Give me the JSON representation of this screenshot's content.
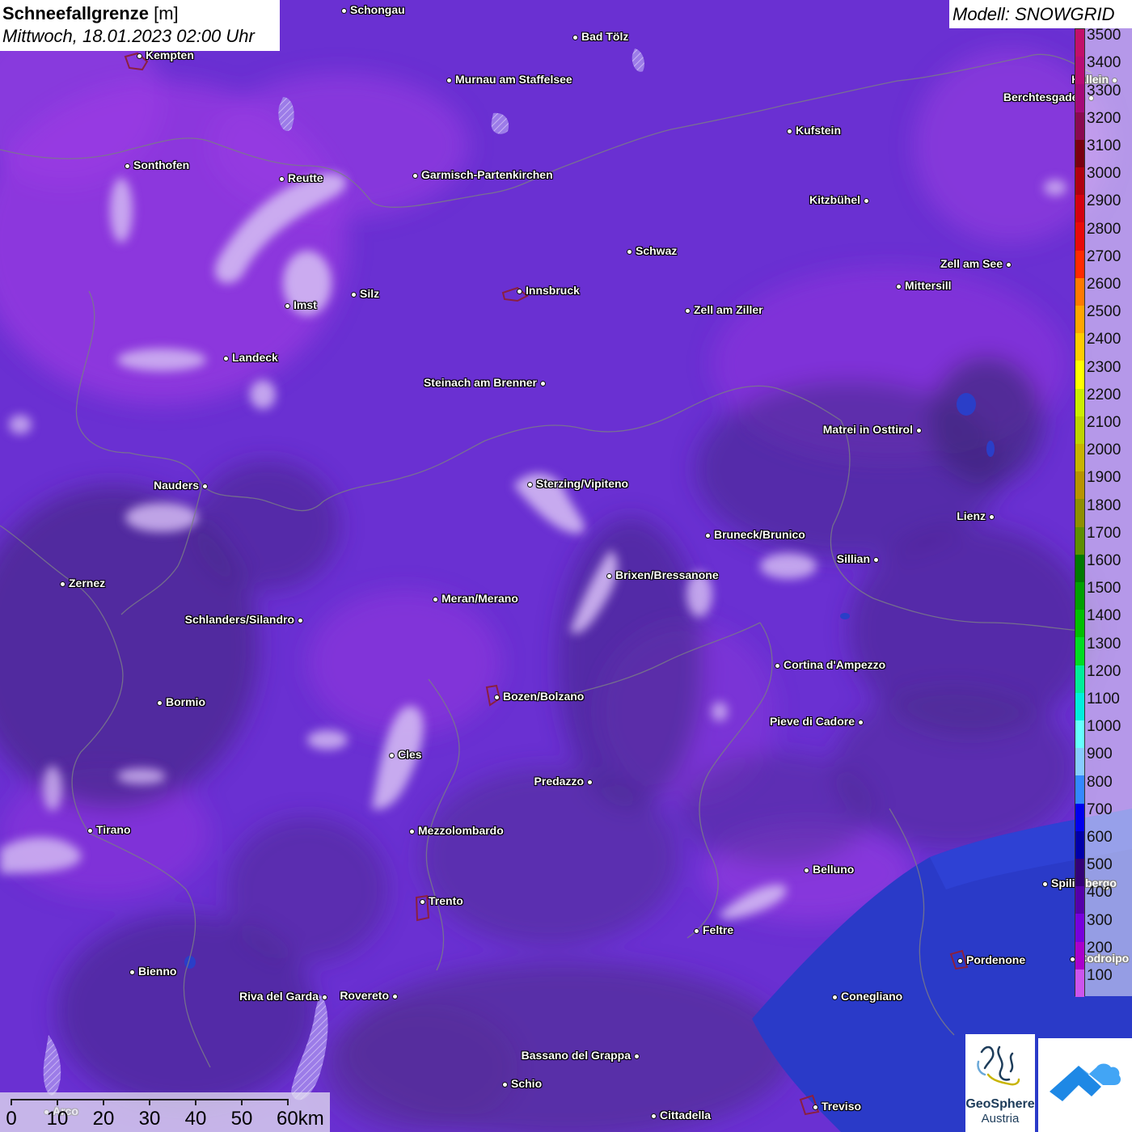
{
  "title": {
    "variable": "Schneefallgrenze",
    "unit": "[m]",
    "datetime": "Mittwoch, 18.01.2023 02:00 Uhr"
  },
  "model": {
    "label": "Modell: SNOWGRID"
  },
  "legend": {
    "levels": [
      {
        "label": "3500",
        "color": "#c2106a"
      },
      {
        "label": "3400",
        "color": "#b80c75"
      },
      {
        "label": "3300",
        "color": "#a50a78"
      },
      {
        "label": "3200",
        "color": "#8a0a50"
      },
      {
        "label": "3100",
        "color": "#7a0010"
      },
      {
        "label": "3000",
        "color": "#b00010"
      },
      {
        "label": "2900",
        "color": "#d40010"
      },
      {
        "label": "2800",
        "color": "#e80a0a"
      },
      {
        "label": "2700",
        "color": "#ff2a00"
      },
      {
        "label": "2600",
        "color": "#ff7a00"
      },
      {
        "label": "2500",
        "color": "#ffa600"
      },
      {
        "label": "2400",
        "color": "#ffcc00"
      },
      {
        "label": "2300",
        "color": "#ffff00"
      },
      {
        "label": "2200",
        "color": "#ccee00"
      },
      {
        "label": "2100",
        "color": "#bfd400"
      },
      {
        "label": "2000",
        "color": "#c8b400"
      },
      {
        "label": "1900",
        "color": "#b89400"
      },
      {
        "label": "1800",
        "color": "#8f8f00"
      },
      {
        "label": "1700",
        "color": "#5e8f00"
      },
      {
        "label": "1600",
        "color": "#007a00"
      },
      {
        "label": "1500",
        "color": "#00a000"
      },
      {
        "label": "1400",
        "color": "#00c000"
      },
      {
        "label": "1300",
        "color": "#00dd22"
      },
      {
        "label": "1200",
        "color": "#00ee99"
      },
      {
        "label": "1100",
        "color": "#00eedd"
      },
      {
        "label": "1000",
        "color": "#66ffff"
      },
      {
        "label": "900",
        "color": "#88ccff"
      },
      {
        "label": "800",
        "color": "#3388ff"
      },
      {
        "label": "700",
        "color": "#0000ee"
      },
      {
        "label": "600",
        "color": "#0000aa"
      },
      {
        "label": "500",
        "color": "#330077"
      },
      {
        "label": "400",
        "color": "#5500aa"
      },
      {
        "label": "300",
        "color": "#7700dd"
      },
      {
        "label": "200",
        "color": "#aa00cc"
      },
      {
        "label": "100",
        "color": "#cc55ee"
      }
    ]
  },
  "scalebar": {
    "ticks": [
      "0",
      "10",
      "20",
      "30",
      "40",
      "50",
      "60km"
    ]
  },
  "logos": {
    "geosphere_line1": "GeoSphere",
    "geosphere_line2": "Austria"
  },
  "colors": {
    "base_purple": "#6a2fd0",
    "dark_purple": "#4a2a8a",
    "magenta": "#a040e0",
    "light_lilac": "#d8c0f0",
    "sea_blue": "#2a38c8"
  },
  "cities": [
    {
      "name": "Schongau",
      "side": "right"
    },
    {
      "name": "Bad Tölz",
      "side": "right"
    },
    {
      "name": "Kempten",
      "side": "right"
    },
    {
      "name": "Murnau am Staffelsee",
      "side": "right"
    },
    {
      "name": "Hallein",
      "side": "left"
    },
    {
      "name": "Berchtesgaden",
      "side": "left"
    },
    {
      "name": "Kufstein",
      "side": "right"
    },
    {
      "name": "Sonthofen",
      "side": "right"
    },
    {
      "name": "Reutte",
      "side": "right"
    },
    {
      "name": "Garmisch-Partenkirchen",
      "side": "right"
    },
    {
      "name": "Kitzbühel",
      "side": "left"
    },
    {
      "name": "Schwaz",
      "side": "right"
    },
    {
      "name": "Zell am See",
      "side": "left"
    },
    {
      "name": "Mittersill",
      "side": "right"
    },
    {
      "name": "Innsbruck",
      "side": "right"
    },
    {
      "name": "Silz",
      "side": "right"
    },
    {
      "name": "Imst",
      "side": "right"
    },
    {
      "name": "Zell am Ziller",
      "side": "right"
    },
    {
      "name": "Landeck",
      "side": "right"
    },
    {
      "name": "Steinach am Brenner",
      "side": "left"
    },
    {
      "name": "Matrei in Osttirol",
      "side": "left"
    },
    {
      "name": "Nauders",
      "side": "left"
    },
    {
      "name": "Sterzing/Vipiteno",
      "side": "right"
    },
    {
      "name": "Lienz",
      "side": "left"
    },
    {
      "name": "Bruneck/Brunico",
      "side": "right"
    },
    {
      "name": "Sillian",
      "side": "left"
    },
    {
      "name": "Brixen/Bressanone",
      "side": "right"
    },
    {
      "name": "Zernez",
      "side": "right"
    },
    {
      "name": "Meran/Merano",
      "side": "right"
    },
    {
      "name": "Schlanders/Silandro",
      "side": "left"
    },
    {
      "name": "Cortina d'Ampezzo",
      "side": "right"
    },
    {
      "name": "Bozen/Bolzano",
      "side": "right"
    },
    {
      "name": "Bormio",
      "side": "right"
    },
    {
      "name": "Pieve di Cadore",
      "side": "left"
    },
    {
      "name": "Cles",
      "side": "right"
    },
    {
      "name": "Predazzo",
      "side": "left"
    },
    {
      "name": "Tirano",
      "side": "right"
    },
    {
      "name": "Mezzolombardo",
      "side": "right"
    },
    {
      "name": "Belluno",
      "side": "right"
    },
    {
      "name": "Spilimbergo",
      "side": "right"
    },
    {
      "name": "Trento",
      "side": "right"
    },
    {
      "name": "Feltre",
      "side": "right"
    },
    {
      "name": "Pordenone",
      "side": "right"
    },
    {
      "name": "Codroipo",
      "side": "right"
    },
    {
      "name": "Bienno",
      "side": "right"
    },
    {
      "name": "Riva del Garda",
      "side": "left"
    },
    {
      "name": "Rovereto",
      "side": "left"
    },
    {
      "name": "Conegliano",
      "side": "right"
    },
    {
      "name": "Bassano del Grappa",
      "side": "left"
    },
    {
      "name": "Schio",
      "side": "right"
    },
    {
      "name": "Treviso",
      "side": "right"
    },
    {
      "name": "Cittadella",
      "side": "right"
    },
    {
      "name": "Arco",
      "side": "right"
    }
  ]
}
